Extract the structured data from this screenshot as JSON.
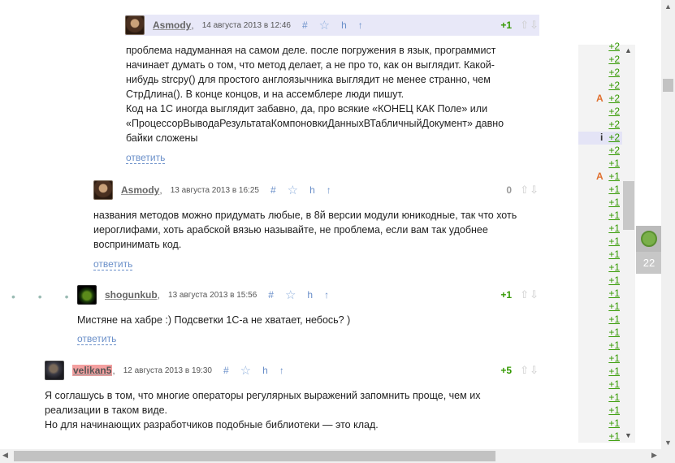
{
  "comments": [
    {
      "username": "Asmody",
      "date": "14 августа 2013 в 12:46",
      "score": "+1",
      "body": [
        "проблема надуманная на самом деле. после погружения в язык, программист",
        "начинает думать о том, что метод делает, а не про то, как он выглядит. Какой-",
        "нибудь strcpy() для простого англоязычника выглядит не менее странно, чем",
        "СтрДлина(). В конце концов, и на ассемблере люди пишут.",
        "Код на 1С иногда выглядит забавно, да, про всякие «КОНЕЦ КАК Поле» или",
        "«ПроцессорВыводаРезультатаКомпоновкиДанныхВТабличныйДокумент» давно",
        "байки сложены"
      ],
      "reply": "ответить"
    },
    {
      "username": "Asmody",
      "date": "13 августа 2013 в 16:25",
      "score": "0",
      "body": [
        "названия методов можно придумать любые, в 8й версии модули юникодные, так что хоть",
        "иероглифами, хоть арабской вязью называйте, не проблема, если вам так удобнее",
        "воспринимать код."
      ],
      "reply": "ответить"
    },
    {
      "username": "shogunkub",
      "date": "13 августа 2013 в 15:56",
      "score": "+1",
      "body": [
        "Мистяне на хабре :) Подсветки 1С-а не хватает, небось? )"
      ],
      "reply": "ответить"
    },
    {
      "username": "velikan5",
      "date": "12 августа 2013 в 19:30",
      "score": "+5",
      "body": [
        "Я соглашусь в том, что многие операторы регулярных выражений запомнить проще, чем их",
        "реализации в таком виде.",
        "Но для начинающих разработчиков подобные библиотеки — это клад."
      ]
    }
  ],
  "header_icons": {
    "hash": "#",
    "star": "☆",
    "h": "h",
    "up": "↑"
  },
  "vote_arrows": "⇧⇩",
  "comma": ",",
  "dots": "• • • •",
  "rail": {
    "items": [
      {
        "mark": "",
        "score": "+2"
      },
      {
        "mark": "",
        "score": "+2"
      },
      {
        "mark": "",
        "score": "+2"
      },
      {
        "mark": "",
        "score": "+2"
      },
      {
        "mark": "A",
        "score": "+2"
      },
      {
        "mark": "",
        "score": "+2"
      },
      {
        "mark": "",
        "score": "+2"
      },
      {
        "mark": "i",
        "score": "+2"
      },
      {
        "mark": "",
        "score": "+2"
      },
      {
        "mark": "",
        "score": "+1"
      },
      {
        "mark": "A",
        "score": "+1"
      },
      {
        "mark": "",
        "score": "+1"
      },
      {
        "mark": "",
        "score": "+1"
      },
      {
        "mark": "",
        "score": "+1"
      },
      {
        "mark": "",
        "score": "+1"
      },
      {
        "mark": "",
        "score": "+1"
      },
      {
        "mark": "",
        "score": "+1"
      },
      {
        "mark": "",
        "score": "+1"
      },
      {
        "mark": "",
        "score": "+1"
      },
      {
        "mark": "",
        "score": "+1"
      },
      {
        "mark": "",
        "score": "+1"
      },
      {
        "mark": "",
        "score": "+1"
      },
      {
        "mark": "",
        "score": "+1"
      },
      {
        "mark": "",
        "score": "+1"
      },
      {
        "mark": "",
        "score": "+1"
      },
      {
        "mark": "",
        "score": "+1"
      },
      {
        "mark": "",
        "score": "+1"
      },
      {
        "mark": "",
        "score": "+1"
      },
      {
        "mark": "",
        "score": "+1"
      },
      {
        "mark": "",
        "score": "+1"
      },
      {
        "mark": "",
        "score": "+1"
      }
    ]
  },
  "refresh": {
    "count": "22"
  },
  "colors": {
    "score_positive": "#339900",
    "link": "#6a8fc9",
    "highlight_user": "#f4a0a0",
    "mark_a": "#e07030"
  }
}
